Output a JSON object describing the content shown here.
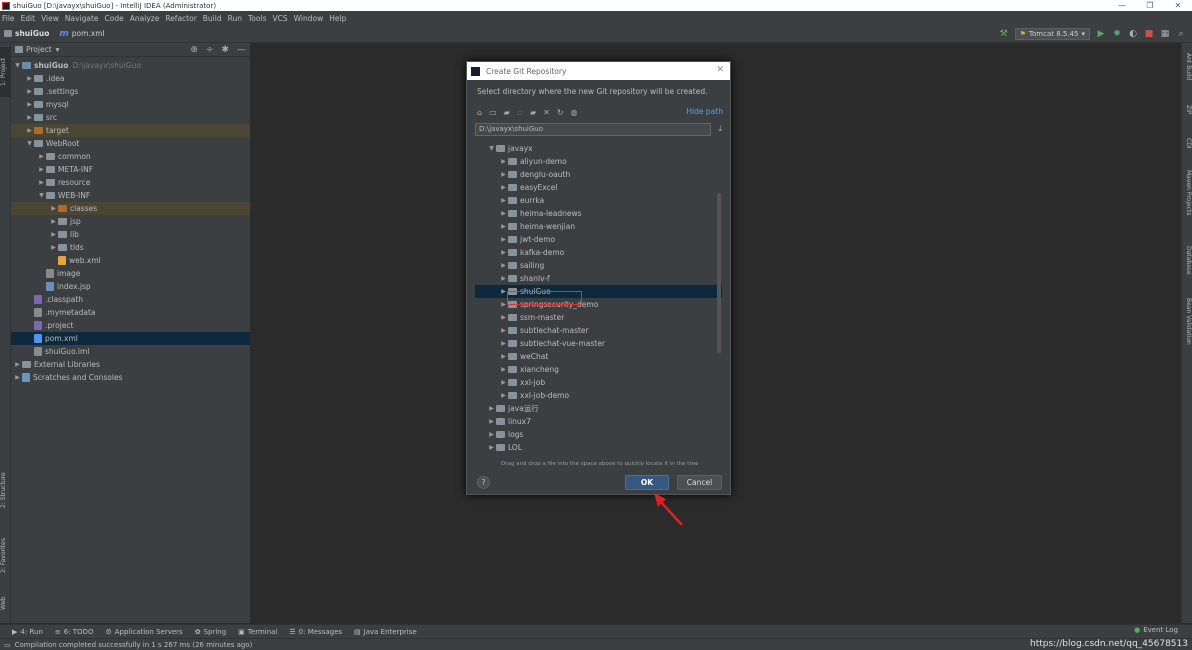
{
  "titlebar": {
    "title": "shuiGuo [D:\\javayx\\shuiGuo] - IntelliJ IDEA (Administrator)",
    "minimize": "—",
    "restore": "❐",
    "close": "✕"
  },
  "menu": [
    "File",
    "Edit",
    "View",
    "Navigate",
    "Code",
    "Analyze",
    "Refactor",
    "Build",
    "Run",
    "Tools",
    "VCS",
    "Window",
    "Help"
  ],
  "nav": {
    "project": "shuiGuo",
    "file": "pom.xml"
  },
  "run": {
    "config": "Tomcat 8.5.45"
  },
  "left_tabs": [
    "1: Project",
    "2: Structure",
    "2: Favorites",
    "Web"
  ],
  "right_tabs": [
    "Ant Build",
    "ZIP",
    "CDI",
    "Maven Projects",
    "Database",
    "Bean Validation"
  ],
  "project_panel": {
    "header": "Project",
    "tree": [
      {
        "label": "shuiGuo",
        "path": "D:\\javayx\\shuiGuo",
        "depth": 0,
        "arrow": "▼",
        "icon": "module",
        "bold": true
      },
      {
        "label": ".idea",
        "depth": 1,
        "arrow": "▶",
        "icon": "folder"
      },
      {
        "label": ".settings",
        "depth": 1,
        "arrow": "▶",
        "icon": "folder"
      },
      {
        "label": "mysql",
        "depth": 1,
        "arrow": "▶",
        "icon": "folder"
      },
      {
        "label": "src",
        "depth": 1,
        "arrow": "▶",
        "icon": "folder"
      },
      {
        "label": "target",
        "depth": 1,
        "arrow": "▶",
        "icon": "folder-orange",
        "hl": true
      },
      {
        "label": "WebRoot",
        "depth": 1,
        "arrow": "▼",
        "icon": "folder"
      },
      {
        "label": "common",
        "depth": 2,
        "arrow": "▶",
        "icon": "folder"
      },
      {
        "label": "META-INF",
        "depth": 2,
        "arrow": "▶",
        "icon": "folder"
      },
      {
        "label": "resource",
        "depth": 2,
        "arrow": "▶",
        "icon": "folder"
      },
      {
        "label": "WEB-INF",
        "depth": 2,
        "arrow": "▼",
        "icon": "folder"
      },
      {
        "label": "classes",
        "depth": 3,
        "arrow": "▶",
        "icon": "folder-orange",
        "hl": true
      },
      {
        "label": "jsp",
        "depth": 3,
        "arrow": "▶",
        "icon": "folder"
      },
      {
        "label": "lib",
        "depth": 3,
        "arrow": "▶",
        "icon": "folder"
      },
      {
        "label": "tlds",
        "depth": 3,
        "arrow": "▶",
        "icon": "folder"
      },
      {
        "label": "web.xml",
        "depth": 3,
        "arrow": "",
        "icon": "xml"
      },
      {
        "label": "image",
        "depth": 2,
        "arrow": "",
        "icon": "file-grey"
      },
      {
        "label": "index.jsp",
        "depth": 2,
        "arrow": "",
        "icon": "jsp"
      },
      {
        "label": ".classpath",
        "depth": 1,
        "arrow": "",
        "icon": "eclipse"
      },
      {
        "label": ".mymetadata",
        "depth": 1,
        "arrow": "",
        "icon": "file-grey"
      },
      {
        "label": ".project",
        "depth": 1,
        "arrow": "",
        "icon": "eclipse"
      },
      {
        "label": "pom.xml",
        "depth": 1,
        "arrow": "",
        "icon": "maven",
        "sel": true
      },
      {
        "label": "shuiGuo.iml",
        "depth": 1,
        "arrow": "",
        "icon": "file-grey"
      },
      {
        "label": "External Libraries",
        "depth": 0,
        "arrow": "▶",
        "icon": "lib"
      },
      {
        "label": "Scratches and Consoles",
        "depth": 0,
        "arrow": "▶",
        "icon": "scratch"
      }
    ]
  },
  "dialog": {
    "title": "Create Git Repository",
    "description": "Select directory where the new Git repository will be created.",
    "hide_path": "Hide path",
    "path_value": "D:\\javayx\\shuiGuo",
    "tree": [
      {
        "label": "javayx",
        "depth": 1,
        "arrow": "▼"
      },
      {
        "label": "aliyun-demo",
        "depth": 2,
        "arrow": "▶"
      },
      {
        "label": "denglu-oauth",
        "depth": 2,
        "arrow": "▶"
      },
      {
        "label": "easyExcel",
        "depth": 2,
        "arrow": "▶"
      },
      {
        "label": "eurrka",
        "depth": 2,
        "arrow": "▶"
      },
      {
        "label": "heima-leadnews",
        "depth": 2,
        "arrow": "▶"
      },
      {
        "label": "heima-wenjian",
        "depth": 2,
        "arrow": "▶"
      },
      {
        "label": "jwt-demo",
        "depth": 2,
        "arrow": "▶"
      },
      {
        "label": "kafka-demo",
        "depth": 2,
        "arrow": "▶"
      },
      {
        "label": "sailing",
        "depth": 2,
        "arrow": "▶"
      },
      {
        "label": "shanlv-f",
        "depth": 2,
        "arrow": "▶"
      },
      {
        "label": "shuiGuo",
        "depth": 2,
        "arrow": "▶",
        "sel": true
      },
      {
        "label": "springsecurity_demo",
        "depth": 2,
        "arrow": "▶"
      },
      {
        "label": "ssm-master",
        "depth": 2,
        "arrow": "▶"
      },
      {
        "label": "subtlechat-master",
        "depth": 2,
        "arrow": "▶"
      },
      {
        "label": "subtlechat-vue-master",
        "depth": 2,
        "arrow": "▶"
      },
      {
        "label": "weChat",
        "depth": 2,
        "arrow": "▶"
      },
      {
        "label": "xiancheng",
        "depth": 2,
        "arrow": "▶"
      },
      {
        "label": "xxl-job",
        "depth": 2,
        "arrow": "▶"
      },
      {
        "label": "xxl-job-demo",
        "depth": 2,
        "arrow": "▶"
      },
      {
        "label": "java运行",
        "depth": 1,
        "arrow": "▶"
      },
      {
        "label": "linux7",
        "depth": 1,
        "arrow": "▶"
      },
      {
        "label": "logs",
        "depth": 1,
        "arrow": "▶"
      },
      {
        "label": "LOL",
        "depth": 1,
        "arrow": "▶"
      }
    ],
    "hint": "Drag and drop a file into the space above to quickly locate it in the tree",
    "help": "?",
    "ok": "OK",
    "cancel": "Cancel"
  },
  "bottom_tabs": [
    {
      "icon": "▶",
      "label": "4: Run"
    },
    {
      "icon": "≡",
      "label": "6: TODO"
    },
    {
      "icon": "⚙",
      "label": "Application Servers"
    },
    {
      "icon": "✿",
      "label": "Spring"
    },
    {
      "icon": "▣",
      "label": "Terminal"
    },
    {
      "icon": "☰",
      "label": "0: Messages"
    },
    {
      "icon": "▤",
      "label": "Java Enterprise"
    }
  ],
  "event_log": "Event Log",
  "status": "Compilation completed successfully in 1 s 267 ms (26 minutes ago)",
  "watermark": "https://blog.csdn.net/qq_45678513",
  "colors": {
    "accent": "#365880",
    "selection": "#0d293e",
    "highlight_box": "#e03030",
    "arrow": "#e02020"
  }
}
